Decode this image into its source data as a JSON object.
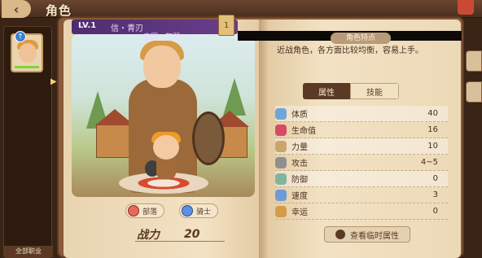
{
  "header": {
    "title": "角色"
  },
  "rail": {
    "badge": "†",
    "bottom_label": "全部职业"
  },
  "card": {
    "level": "LV.1",
    "meta": "信・青刃",
    "meta_sub": "素因・灰羽",
    "bookmark": "1"
  },
  "tags": [
    {
      "label": "部落",
      "color": "#e66a5b"
    },
    {
      "label": "骑士",
      "color": "#5b90e6"
    }
  ],
  "power": {
    "label": "战力",
    "value": "20"
  },
  "right": {
    "trait_title": "角色特点",
    "description": "近战角色，各方面比较均衡，容易上手。",
    "tabs": [
      "属性",
      "技能"
    ],
    "active_tab": "属性",
    "stats": [
      {
        "name": "体质",
        "value": "40",
        "icon": "stamina-icon",
        "color": "#6fa6d8"
      },
      {
        "name": "生命值",
        "value": "16",
        "icon": "heart-icon",
        "color": "#d84a64"
      },
      {
        "name": "力量",
        "value": "10",
        "icon": "fist-icon",
        "color": "#caa56b"
      },
      {
        "name": "攻击",
        "value": "4~5",
        "icon": "sword-icon",
        "color": "#8f8f8f"
      },
      {
        "name": "防御",
        "value": "0",
        "icon": "shield-icon",
        "color": "#7fb5a2"
      },
      {
        "name": "速度",
        "value": "3",
        "icon": "speed-icon",
        "color": "#6e9ad8"
      },
      {
        "name": "幸运",
        "value": "0",
        "icon": "luck-icon",
        "color": "#d59a4a"
      }
    ],
    "view_button": "查看临时属性"
  }
}
